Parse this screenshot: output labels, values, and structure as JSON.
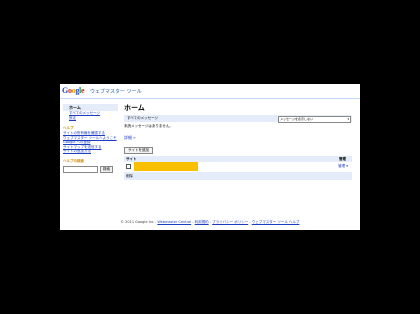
{
  "header": {
    "logo_parts": [
      "G",
      "o",
      "o",
      "g",
      "l",
      "e"
    ],
    "app_title": "ウェブマスター ツール"
  },
  "sidebar": {
    "heading": "ホーム",
    "items": [
      {
        "label": "すべてのメッセージ"
      },
      {
        "label": "設定"
      }
    ],
    "help": {
      "heading": "ヘルプ",
      "links": [
        "サイトの所有権を確認する",
        "ウェブマスター ツールへようこそ",
        "Google への登録",
        "サイトマップを送信する",
        "サイトの追加方法"
      ]
    },
    "search": {
      "heading": "ヘルプの検索",
      "placeholder": "",
      "button": "検索"
    }
  },
  "main": {
    "title": "ホーム",
    "messages": {
      "label": "すべてのメッセージ",
      "filter_value": "メッセージを表示しない",
      "empty_text": "未読メッセージはありません。",
      "more_link": "詳細 »"
    },
    "add_site_button": "サイトを追加",
    "table": {
      "columns": [
        "サイト",
        "管理"
      ],
      "rows": [
        {
          "manage": "管理 ▾"
        }
      ],
      "footer": "削除"
    }
  },
  "footer": {
    "copyright": "© 2011 Google Inc",
    "links": [
      "Webmaster Central",
      "利用規約",
      "プライバシー ポリシー",
      "ウェブマスター ツール ヘルプ"
    ]
  },
  "colors": {
    "accent_bar": "#e5ecf9",
    "highlight": "#f8c000",
    "link": "#1a3dc1"
  }
}
